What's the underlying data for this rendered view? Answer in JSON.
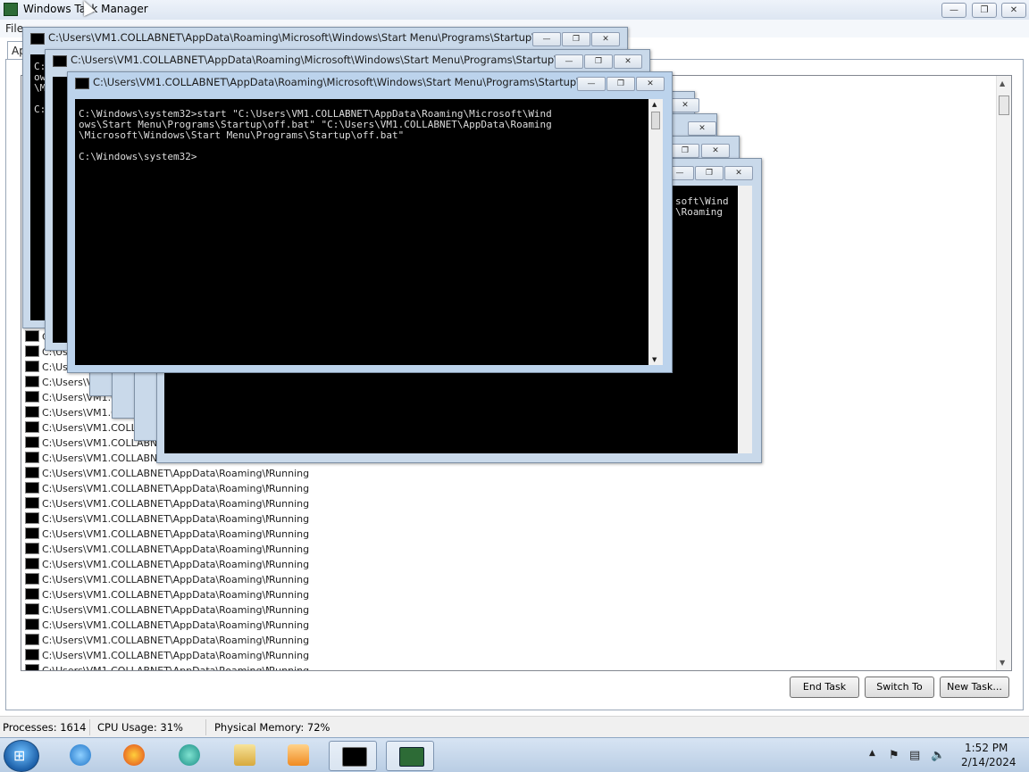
{
  "task_manager": {
    "title": "Windows Task Manager",
    "menu_file": "File",
    "tab_label": "Ap",
    "rows": [
      {
        "task": "C",
        "status": ""
      },
      {
        "task": "C:\\Us",
        "status": ""
      },
      {
        "task": "C:\\Use",
        "status": ""
      },
      {
        "task": "C:\\Users\\V",
        "status": ""
      },
      {
        "task": "C:\\Users\\VM1.C",
        "status": ""
      },
      {
        "task": "C:\\Users\\VM1.CO",
        "status": ""
      },
      {
        "task": "C:\\Users\\VM1.COLLAB",
        "status": ""
      },
      {
        "task": "C:\\Users\\VM1.COLLABNET",
        "status": ""
      },
      {
        "task": "C:\\Users\\VM1.COLLABNET",
        "status": ""
      },
      {
        "task": "C:\\Users\\VM1.COLLABNET\\AppData\\Roaming\\Mi...",
        "status": "Running"
      },
      {
        "task": "C:\\Users\\VM1.COLLABNET\\AppData\\Roaming\\Mi...",
        "status": "Running"
      },
      {
        "task": "C:\\Users\\VM1.COLLABNET\\AppData\\Roaming\\Mi...",
        "status": "Running"
      },
      {
        "task": "C:\\Users\\VM1.COLLABNET\\AppData\\Roaming\\Mi...",
        "status": "Running"
      },
      {
        "task": "C:\\Users\\VM1.COLLABNET\\AppData\\Roaming\\Mi...",
        "status": "Running"
      },
      {
        "task": "C:\\Users\\VM1.COLLABNET\\AppData\\Roaming\\Mi...",
        "status": "Running"
      },
      {
        "task": "C:\\Users\\VM1.COLLABNET\\AppData\\Roaming\\Mi...",
        "status": "Running"
      },
      {
        "task": "C:\\Users\\VM1.COLLABNET\\AppData\\Roaming\\Mi...",
        "status": "Running"
      },
      {
        "task": "C:\\Users\\VM1.COLLABNET\\AppData\\Roaming\\Mi...",
        "status": "Running"
      },
      {
        "task": "C:\\Users\\VM1.COLLABNET\\AppData\\Roaming\\Mi...",
        "status": "Running"
      },
      {
        "task": "C:\\Users\\VM1.COLLABNET\\AppData\\Roaming\\Mi...",
        "status": "Running"
      },
      {
        "task": "C:\\Users\\VM1.COLLABNET\\AppData\\Roaming\\Mi...",
        "status": "Running"
      },
      {
        "task": "C:\\Users\\VM1.COLLABNET\\AppData\\Roaming\\Mi...",
        "status": "Running"
      },
      {
        "task": "C:\\Users\\VM1.COLLABNET\\AppData\\Roaming\\Mi...",
        "status": "Running"
      }
    ],
    "buttons": {
      "end_task": "End Task",
      "switch_to": "Switch To",
      "new_task": "New Task..."
    },
    "status": {
      "processes": "Processes: 1614",
      "cpu": "CPU Usage: 31%",
      "memory": "Physical Memory: 72%"
    }
  },
  "console": {
    "window_title": "C:\\Users\\VM1.COLLABNET\\AppData\\Roaming\\Microsoft\\Windows\\Start Menu\\Programs\\Startup\\...",
    "front_text": "C:\\Windows\\system32>start \"C:\\Users\\VM1.COLLABNET\\AppData\\Roaming\\Microsoft\\Wind\nows\\Start Menu\\Programs\\Startup\\off.bat\" \"C:\\Users\\VM1.COLLABNET\\AppData\\Roaming\n\\Microsoft\\Windows\\Start Menu\\Programs\\Startup\\off.bat\"\n\nC:\\Windows\\system32>",
    "back_left_text": "C:\nows\n\\M\n\nC:",
    "back_right_text": "soft\\Wind\n\\Roaming"
  },
  "taskbar": {
    "start": "⊞",
    "time": "1:52 PM",
    "date": "2/14/2024"
  },
  "colors": {
    "console_bg": "#000000",
    "console_fg": "#dcdcdc",
    "titlebar": "#c9d9ea"
  }
}
